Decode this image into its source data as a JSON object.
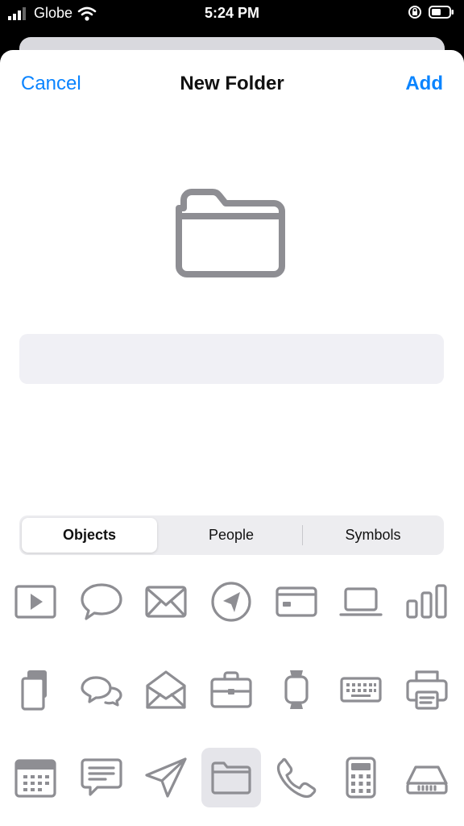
{
  "status_bar": {
    "carrier": "Globe",
    "time": "5:24 PM",
    "icons": [
      "signal-icon",
      "wifi-icon",
      "orientation-lock-icon",
      "battery-icon"
    ]
  },
  "nav": {
    "cancel_label": "Cancel",
    "title": "New Folder",
    "add_label": "Add"
  },
  "folder_name": {
    "value": "",
    "placeholder": ""
  },
  "segments": {
    "items": [
      "Objects",
      "People",
      "Symbols"
    ],
    "selected": "Objects"
  },
  "icon_grid": [
    [
      "play-rectangle-icon",
      "speech-bubble-icon",
      "envelope-icon",
      "location-arrow-circle-icon",
      "credit-card-icon",
      "laptop-icon",
      "bar-chart-icon"
    ],
    [
      "documents-icon",
      "two-speech-bubbles-icon",
      "open-envelope-icon",
      "briefcase-icon",
      "watch-icon",
      "keyboard-icon",
      "printer-icon"
    ],
    [
      "calendar-icon",
      "text-bubble-icon",
      "paper-plane-icon",
      "folder-icon",
      "phone-icon",
      "calculator-icon",
      "hard-drive-icon"
    ]
  ],
  "selected_icon": "folder-icon",
  "colors": {
    "accent": "#0a84ff",
    "icon_gray": "#8e8e93",
    "field_bg": "#f0f0f5",
    "selected_bg": "#e5e5ea"
  }
}
